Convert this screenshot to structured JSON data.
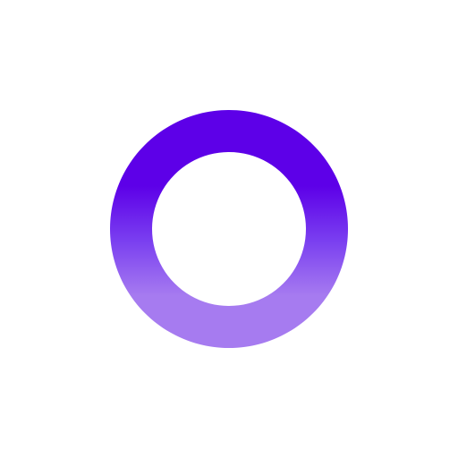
{
  "icon": {
    "name": "circle-ring-icon",
    "colors": {
      "background": "#ffffff",
      "gradient_top": "#5d00e8",
      "gradient_mid": "#7a3ff0",
      "gradient_bottom": "#a67bf0"
    }
  }
}
